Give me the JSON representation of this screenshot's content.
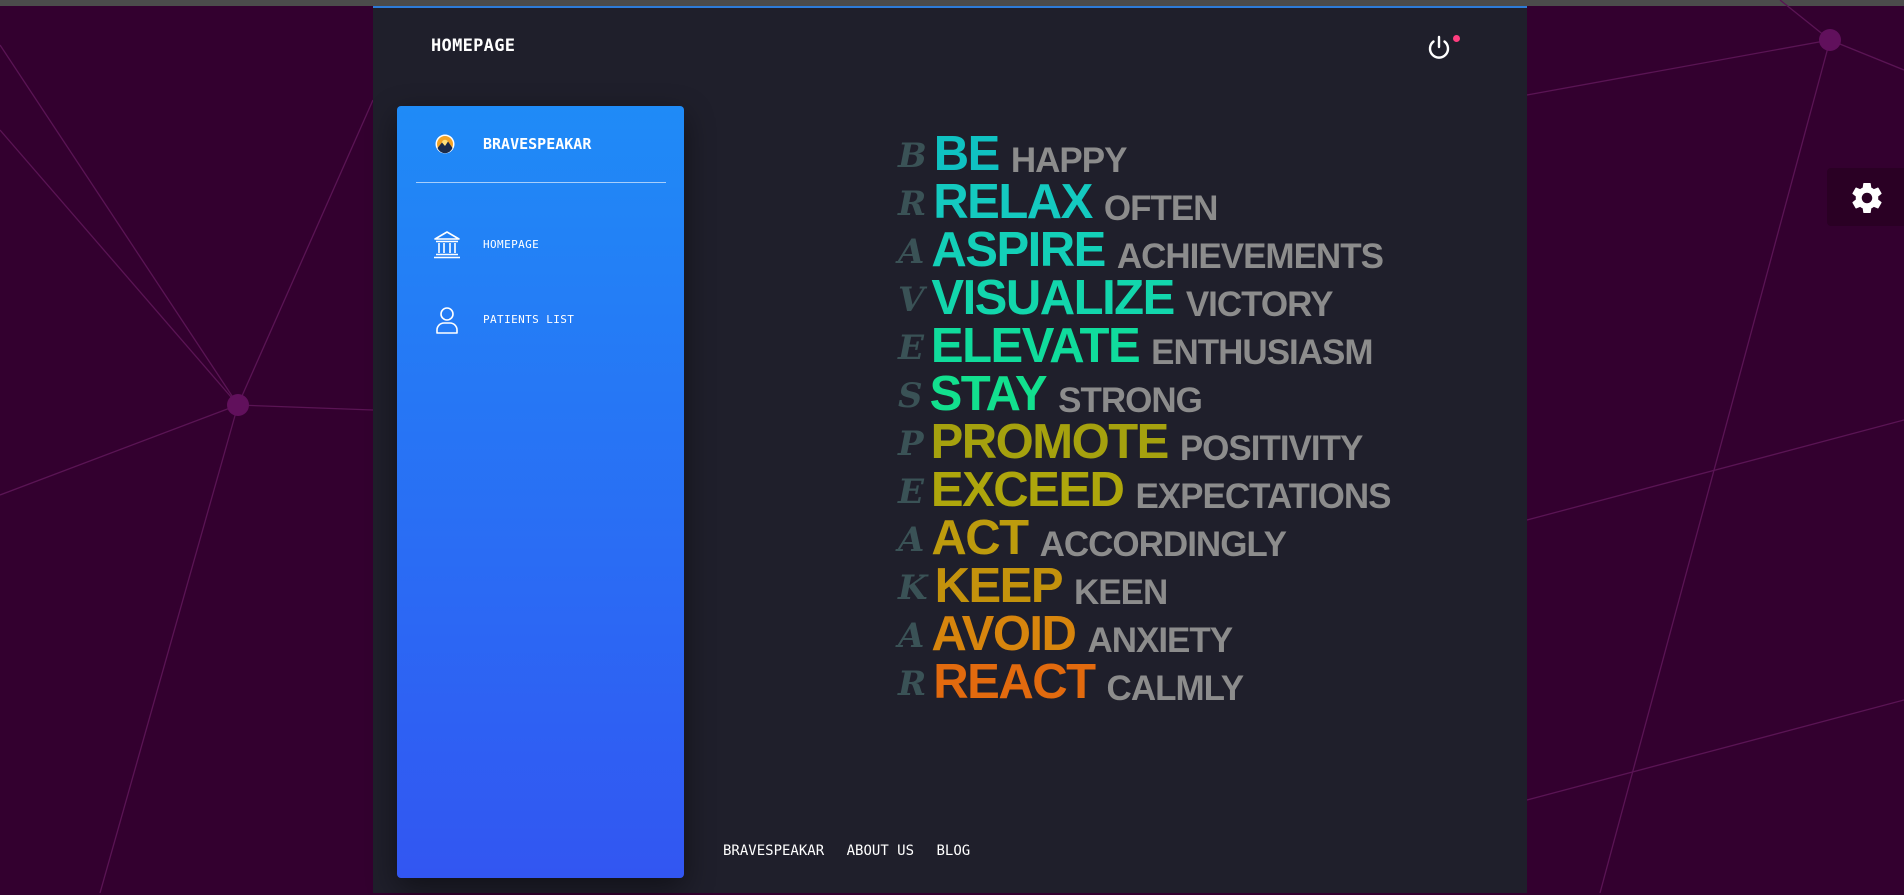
{
  "header": {
    "title": "HOMEPAGE"
  },
  "sidebar": {
    "brand": "BRAVESPEAKAR",
    "items": [
      {
        "label": "HOMEPAGE",
        "icon": "bank-icon"
      },
      {
        "label": "PATIENTS LIST",
        "icon": "user-icon"
      }
    ]
  },
  "acrostic": [
    {
      "letter": "B",
      "word": "BE",
      "rest": "HAPPY",
      "color": "#0fc2c2"
    },
    {
      "letter": "R",
      "word": "RELAX",
      "rest": "OFTEN",
      "color": "#14cac0"
    },
    {
      "letter": "A",
      "word": "ASPIRE",
      "rest": "ACHIEVEMENTS",
      "color": "#13d0b8"
    },
    {
      "letter": "V",
      "word": "VISUALIZE",
      "rest": "VICTORY",
      "color": "#12d6ac"
    },
    {
      "letter": "E",
      "word": "ELEVATE",
      "rest": "ENTHUSIASM",
      "color": "#10dc9c"
    },
    {
      "letter": "S",
      "word": "STAY",
      "rest": "STRONG",
      "color": "#12e08e"
    },
    {
      "letter": "P",
      "word": "PROMOTE",
      "rest": "POSITIVITY",
      "color": "#a5a10e"
    },
    {
      "letter": "E",
      "word": "EXCEED",
      "rest": "EXPECTATIONS",
      "color": "#aea60c"
    },
    {
      "letter": "A",
      "word": "ACT",
      "rest": "ACCORDINGLY",
      "color": "#bd9b0d"
    },
    {
      "letter": "K",
      "word": "KEEP",
      "rest": "KEEN",
      "color": "#c3920c"
    },
    {
      "letter": "A",
      "word": "AVOID",
      "rest": "ANXIETY",
      "color": "#d7850d"
    },
    {
      "letter": "R",
      "word": "REACT",
      "rest": "CALMLY",
      "color": "#e26a0e"
    }
  ],
  "footer": {
    "links": [
      "BRAVESPEAKAR",
      "ABOUT US",
      "BLOG"
    ]
  },
  "colors": {
    "panel": "#1f1f2b",
    "background": "#33002f",
    "accent": "#1f8bf7",
    "notification": "#ff3d7f"
  },
  "icons": {
    "power": "power-icon",
    "settings": "gear-icon",
    "logo": "mountain-sun-logo-icon"
  }
}
